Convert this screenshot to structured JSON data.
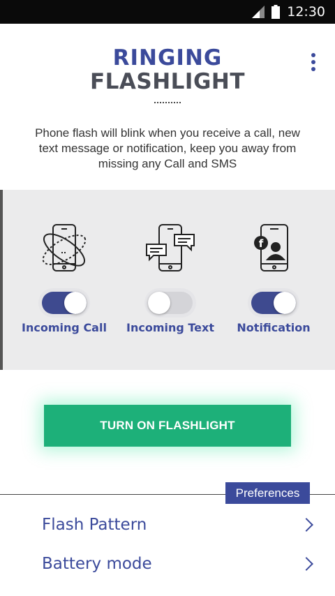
{
  "status_bar": {
    "time": "12:30"
  },
  "header": {
    "title_line1": "RINGING",
    "title_line2": "FLASHLIGHT",
    "description": "Phone flash will blink when you receive a call, new text message or notification, keep you away from missing any Call and SMS"
  },
  "options": [
    {
      "label": "Incoming Call",
      "icon": "phone-ringing-icon",
      "enabled": true
    },
    {
      "label": "Incoming Text",
      "icon": "phone-messages-icon",
      "enabled": false
    },
    {
      "label": "Notification",
      "icon": "phone-notification-icon",
      "enabled": true
    }
  ],
  "cta": {
    "label": "TURN ON FLASHLIGHT"
  },
  "preferences": {
    "badge": "Preferences",
    "items": [
      {
        "label": "Flash Pattern"
      },
      {
        "label": "Battery mode"
      }
    ]
  },
  "colors": {
    "accent": "#3b4a9b",
    "cta": "#1db079",
    "panel": "#ebebec"
  }
}
